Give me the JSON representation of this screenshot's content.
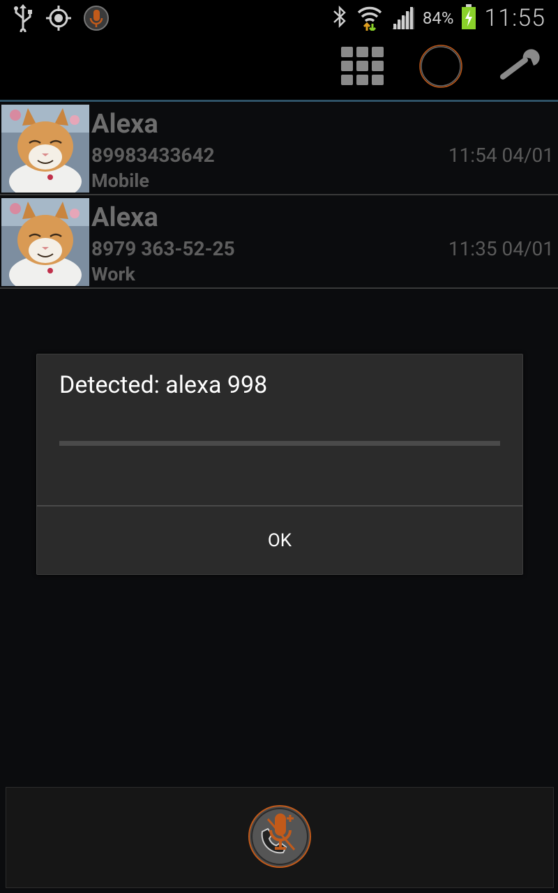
{
  "status_bar": {
    "battery_percent": "84%",
    "time": "11:55",
    "icons": [
      "usb-icon",
      "gps-icon",
      "app-mic-icon",
      "bluetooth-icon",
      "wifi-icon",
      "signal-icon",
      "battery-icon"
    ]
  },
  "action_bar": {
    "icons": [
      "dialpad-icon",
      "voice-record-icon",
      "settings-wrench-icon"
    ]
  },
  "contacts": [
    {
      "name": "Alexa",
      "number": "89983433642",
      "type": "Mobile",
      "time": "11:54 04/01"
    },
    {
      "name": "Alexa",
      "number": "8979 363-52-25",
      "type": "Work",
      "time": "11:35 04/01"
    }
  ],
  "dialog": {
    "title": "Detected: alexa 998",
    "ok_label": "OK",
    "progress": 0
  },
  "bottom_bar": {
    "icon": "voice-dial-mic-icon"
  },
  "colors": {
    "accent_orange": "#c25a1a",
    "divider_blue": "#2f5266",
    "dialog_bg": "#2b2b2b",
    "battery_green": "#8ad12a"
  }
}
